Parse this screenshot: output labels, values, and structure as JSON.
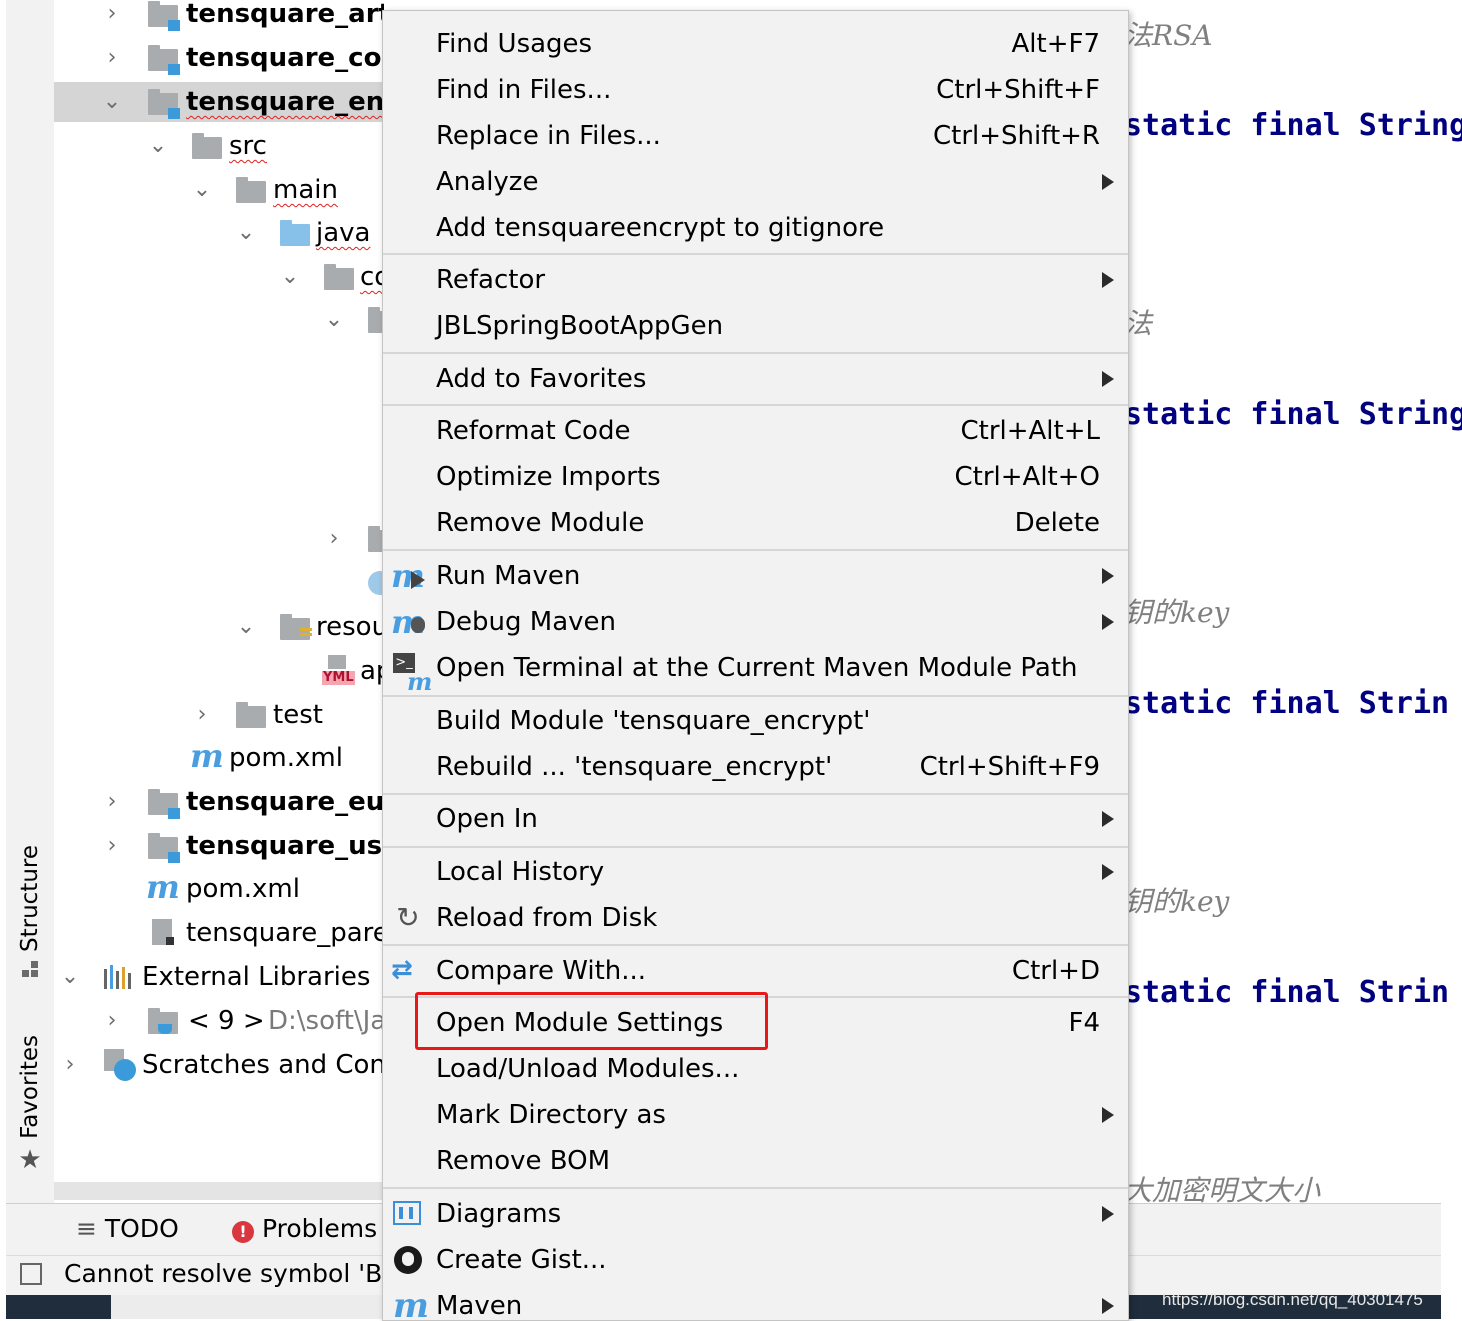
{
  "tool_strip": {
    "structure": "Structure",
    "favorites": "Favorites"
  },
  "tree": {
    "items": [
      {
        "label": "tensquare_artic"
      },
      {
        "label": "tensquare_com"
      },
      {
        "label": "tensquare_encr"
      },
      {
        "label": "src"
      },
      {
        "label": "main"
      },
      {
        "label": "java"
      },
      {
        "label": "co"
      },
      {
        "label": "resou"
      },
      {
        "label": "ap"
      },
      {
        "label": "test"
      },
      {
        "label": "pom.xml"
      },
      {
        "label": "tensquare_eure"
      },
      {
        "label": "tensquare_user"
      },
      {
        "label": "pom.xml"
      },
      {
        "label": "tensquare_pare"
      },
      {
        "label": "External Libraries"
      },
      {
        "label": "< 9 >",
        "path": "D:\\soft\\Ja"
      },
      {
        "label": "Scratches and Cons"
      }
    ],
    "yml_badge": "YML"
  },
  "code": {
    "lines": [
      {
        "comment": "法RSA"
      },
      {
        "code": "static final String"
      },
      {
        "comment": "法"
      },
      {
        "code": "static final String"
      },
      {
        "comment": "钥的key"
      },
      {
        "code": "static final Strin"
      },
      {
        "comment": "钥的key"
      },
      {
        "code": "static final Strin"
      },
      {
        "comment": "大加密明文大小"
      }
    ]
  },
  "bottom_toolbar": {
    "todo": "TODO",
    "problems": "Problems"
  },
  "status": {
    "message": "Cannot resolve symbol 'B"
  },
  "watermark": "https://blog.csdn.net/qq_40301475",
  "menu": {
    "items": [
      {
        "label": "Find Usages",
        "shortcut": "Alt+F7"
      },
      {
        "label": "Find in Files...",
        "shortcut": "Ctrl+Shift+F"
      },
      {
        "label": "Replace in Files...",
        "shortcut": "Ctrl+Shift+R"
      },
      {
        "label": "Analyze",
        "shortcut": ""
      },
      {
        "label": "Add tensquareencrypt to gitignore",
        "shortcut": ""
      },
      {
        "label": "Refactor",
        "shortcut": ""
      },
      {
        "label": "JBLSpringBootAppGen",
        "shortcut": ""
      },
      {
        "label": "Add to Favorites",
        "shortcut": ""
      },
      {
        "label": "Reformat Code",
        "shortcut": "Ctrl+Alt+L"
      },
      {
        "label": "Optimize Imports",
        "shortcut": "Ctrl+Alt+O"
      },
      {
        "label": "Remove Module",
        "shortcut": "Delete"
      },
      {
        "label": "Run Maven",
        "shortcut": ""
      },
      {
        "label": "Debug Maven",
        "shortcut": ""
      },
      {
        "label": "Open Terminal at the Current Maven Module Path",
        "shortcut": ""
      },
      {
        "label": "Build Module 'tensquare_encrypt'",
        "shortcut": ""
      },
      {
        "label": "Rebuild ... 'tensquare_encrypt'",
        "shortcut": "Ctrl+Shift+F9"
      },
      {
        "label": "Open In",
        "shortcut": ""
      },
      {
        "label": "Local History",
        "shortcut": ""
      },
      {
        "label": "Reload from Disk",
        "shortcut": ""
      },
      {
        "label": "Compare With...",
        "shortcut": "Ctrl+D"
      },
      {
        "label": "Open Module Settings",
        "shortcut": "F4"
      },
      {
        "label": "Load/Unload Modules...",
        "shortcut": ""
      },
      {
        "label": "Mark Directory as",
        "shortcut": ""
      },
      {
        "label": "Remove BOM",
        "shortcut": ""
      },
      {
        "label": "Diagrams",
        "shortcut": ""
      },
      {
        "label": "Create Gist...",
        "shortcut": ""
      },
      {
        "label": "Maven",
        "shortcut": ""
      }
    ],
    "highlighted_item": "Open Module Settings",
    "highlight_color": "#e8171a"
  }
}
